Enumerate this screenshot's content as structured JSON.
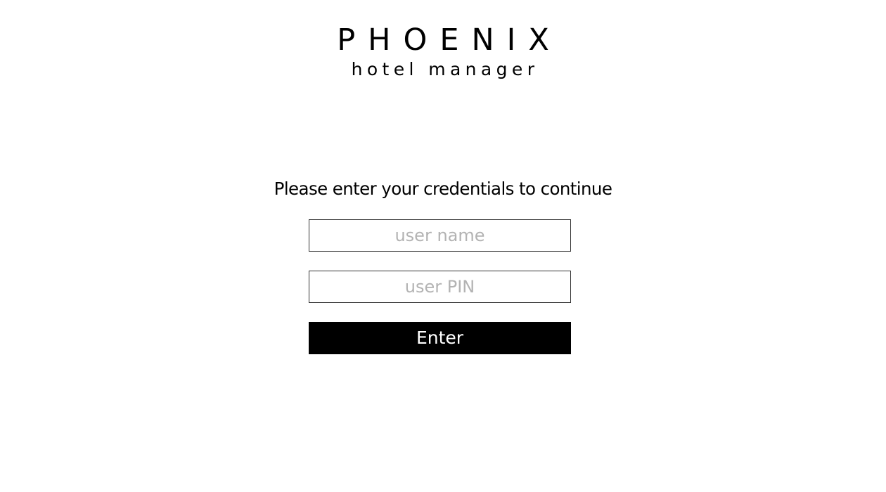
{
  "logo": {
    "title": "PHOENIX",
    "subtitle": "hotel manager"
  },
  "login": {
    "prompt": "Please enter your credentials to continue",
    "username": {
      "value": "",
      "placeholder": "user name"
    },
    "pin": {
      "value": "",
      "placeholder": "user PIN"
    },
    "enter_label": "Enter"
  },
  "colors": {
    "background": "#ffffff",
    "text": "#000000",
    "placeholder": "#b3b3b3",
    "field_border": "#333333",
    "button_background": "#000000",
    "button_text": "#ffffff"
  }
}
